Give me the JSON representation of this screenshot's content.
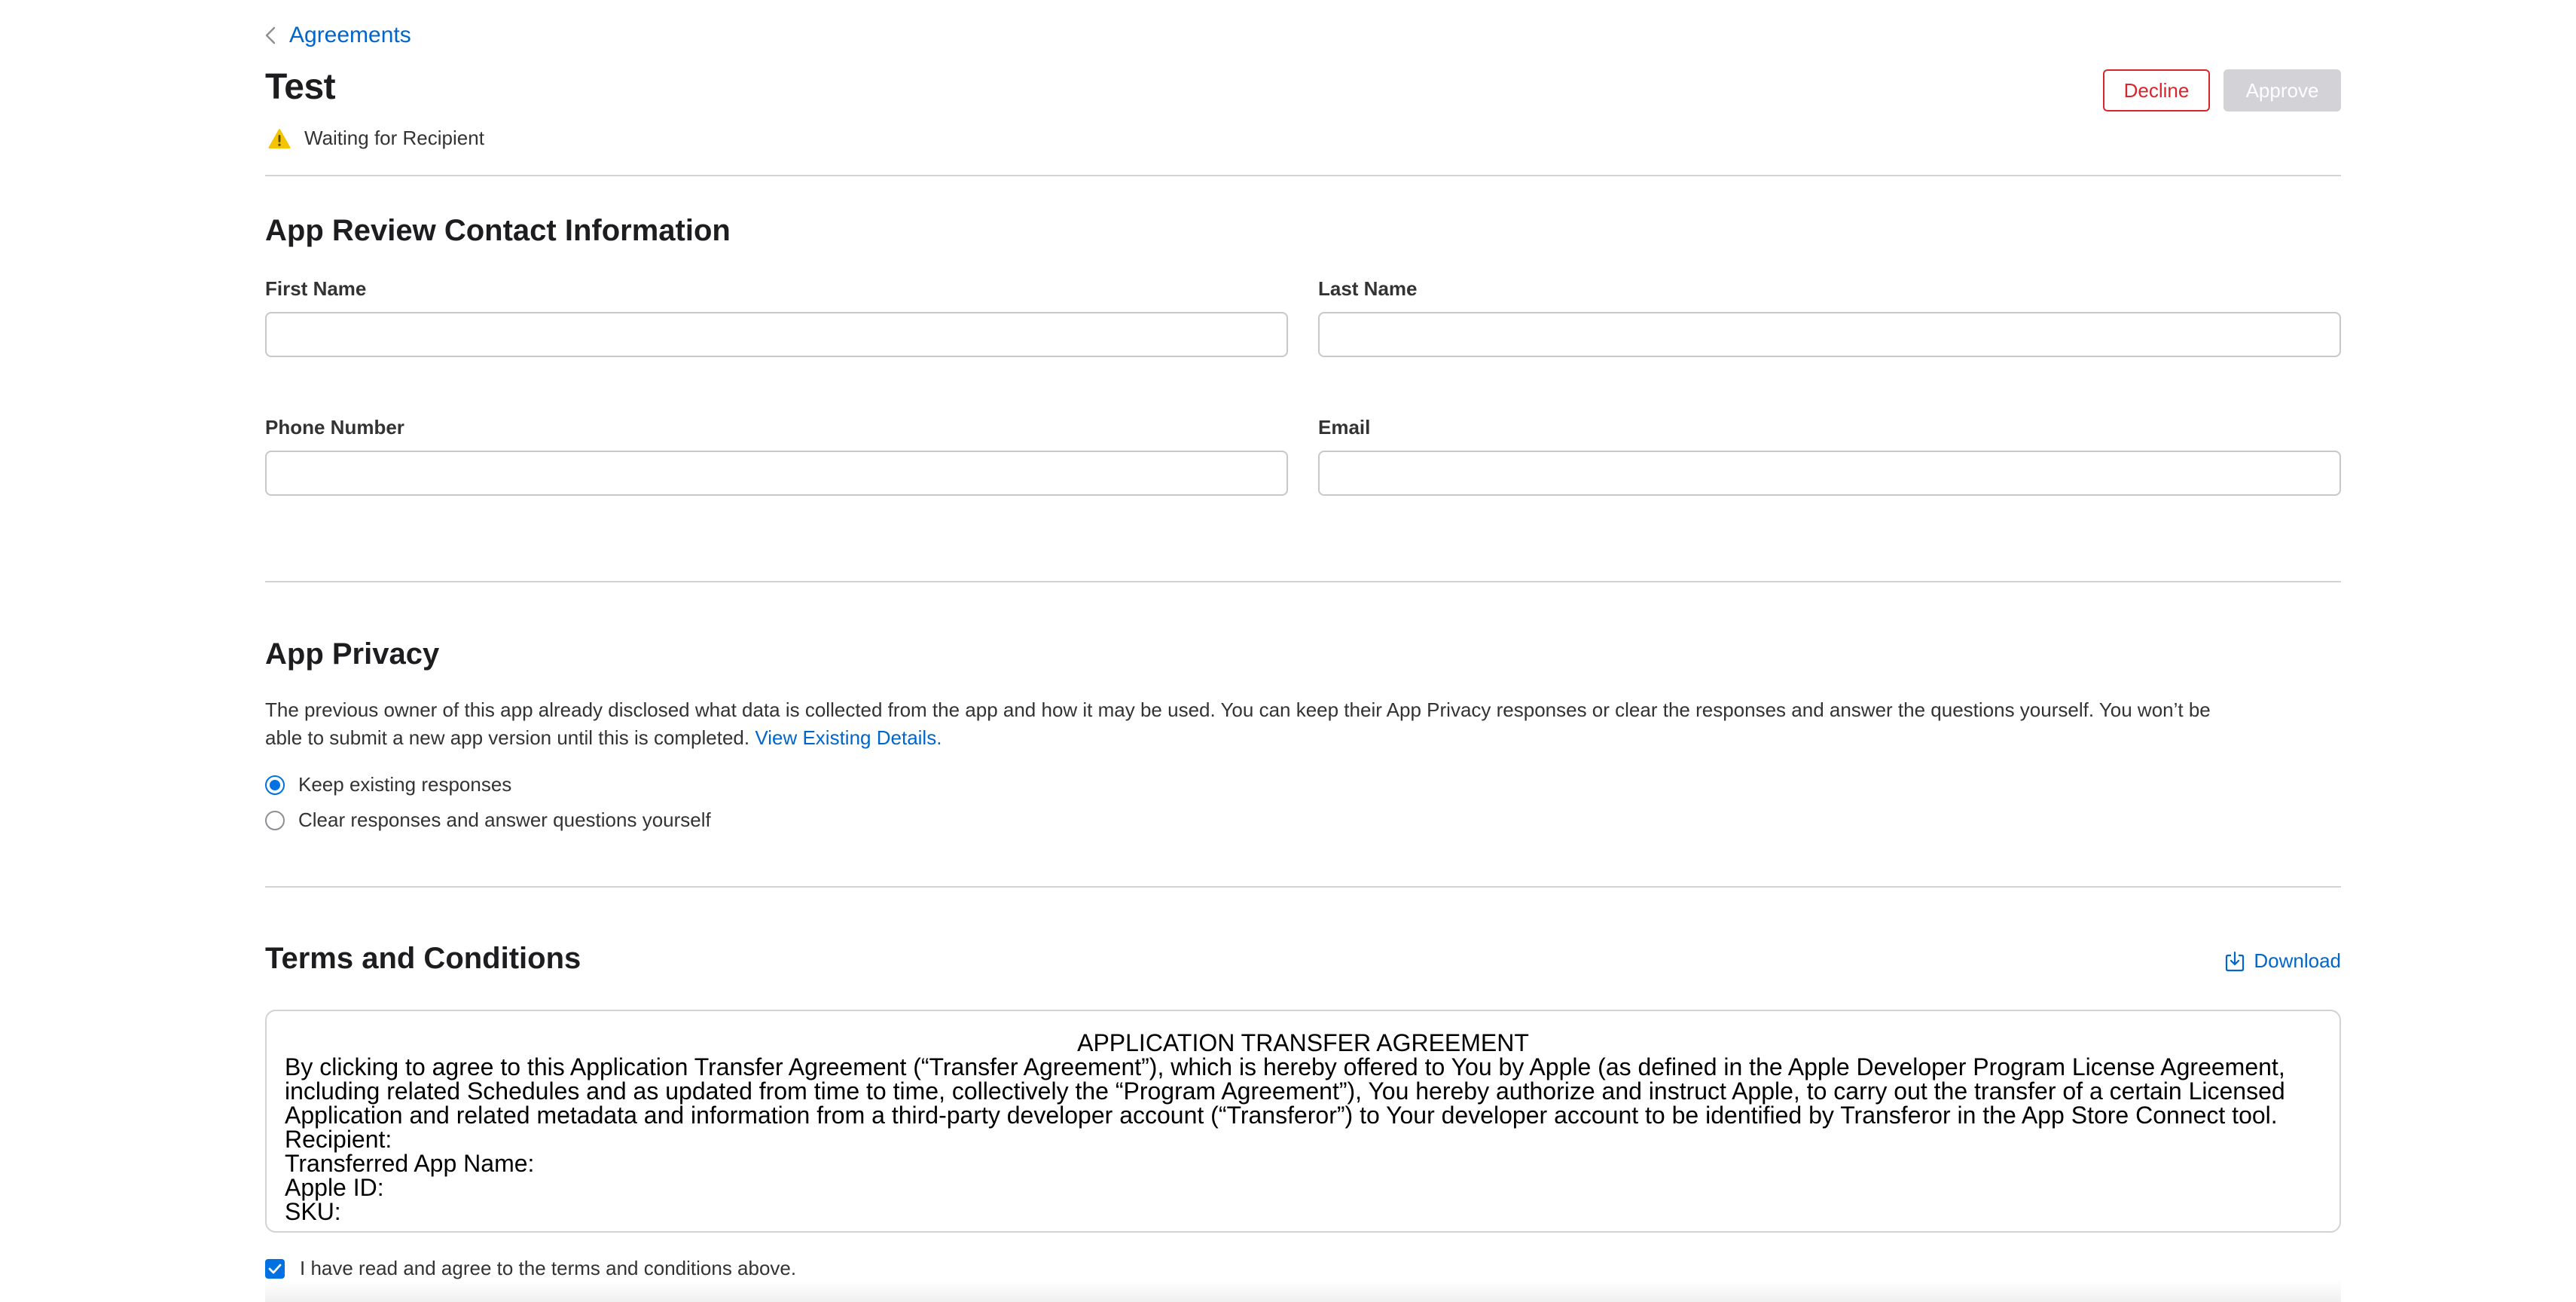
{
  "header": {
    "back_label": "Agreements",
    "title": "Test",
    "status": "Waiting for Recipient",
    "decline_label": "Decline",
    "approve_label": "Approve"
  },
  "contact": {
    "title": "App Review Contact Information",
    "first_name_label": "First Name",
    "first_name_value": "",
    "last_name_label": "Last Name",
    "last_name_value": "",
    "phone_label": "Phone Number",
    "phone_value": "",
    "email_label": "Email",
    "email_value": ""
  },
  "privacy": {
    "title": "App Privacy",
    "description_line1": "The previous owner of this app already disclosed what data is collected from the app and how it may be used. You can keep their App Privacy responses or clear the responses and answer the questions yourself. You won’t be",
    "description_line2": "able to submit a new app version until this is completed.",
    "link_label": "View Existing Details.",
    "options": [
      {
        "label": "Keep existing responses",
        "selected": true
      },
      {
        "label": "Clear responses and answer questions yourself",
        "selected": false
      }
    ]
  },
  "terms": {
    "title": "Terms and Conditions",
    "download_label": "Download",
    "doc_title": "APPLICATION TRANSFER AGREEMENT",
    "lines": [
      "By clicking to agree to this Application Transfer Agreement (“Transfer Agreement”), which is hereby offered to You by Apple (as defined in the Apple Developer Program License Agreement,",
      "including related Schedules and as updated from time to time, collectively the “Program Agreement”), You hereby authorize and instruct Apple, to carry out the transfer of a certain Licensed",
      "Application and related metadata and information from a third-party developer account (“Transferor”) to Your developer account to be identified by Transferor in the App Store Connect tool.",
      "Recipient:",
      "Transferred App Name:",
      "Apple ID:",
      "SKU:"
    ],
    "agree_label": "I have read and agree to the terms and conditions above.",
    "agree_checked": true
  },
  "colors": {
    "accent": "#0071e3",
    "link": "#0066cc",
    "decline": "#d7262e",
    "warning": "#f5c400"
  }
}
